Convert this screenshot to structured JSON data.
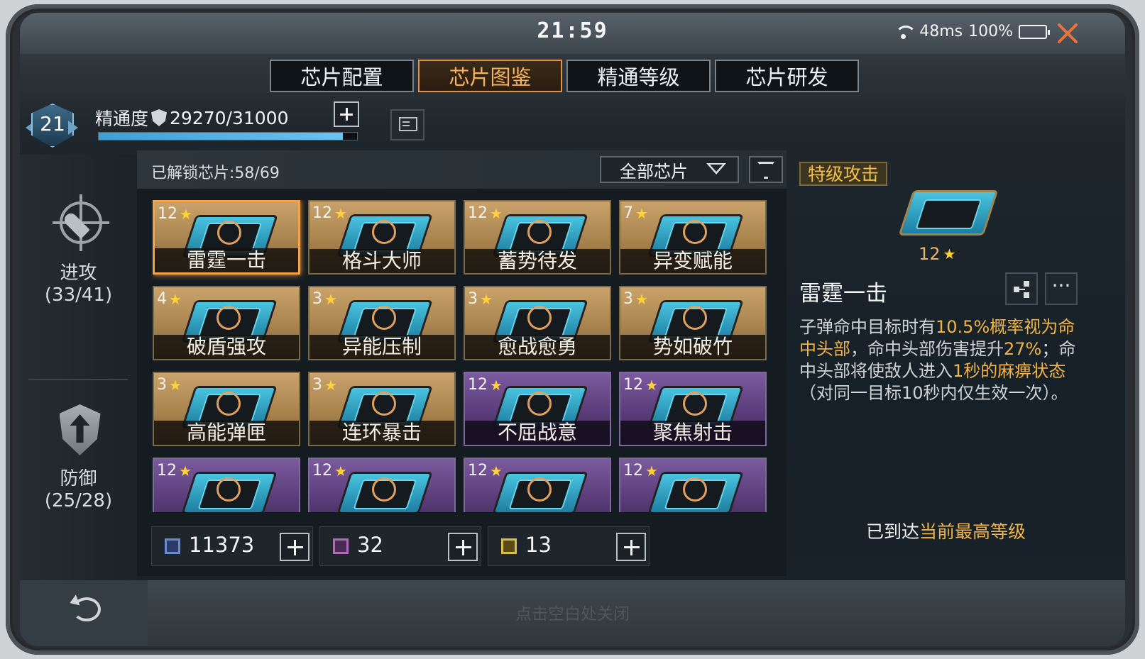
{
  "status_bar": {
    "time": "21:59",
    "ping": "48ms",
    "battery": "100%"
  },
  "tabs": [
    {
      "label": "芯片配置",
      "active": false
    },
    {
      "label": "芯片图鉴",
      "active": true
    },
    {
      "label": "精通等级",
      "active": false
    },
    {
      "label": "芯片研发",
      "active": false
    }
  ],
  "mastery": {
    "level": "21",
    "label": "精通度",
    "value": "29270/31000",
    "progress": 0.944
  },
  "categories": {
    "attack": {
      "name": "进攻",
      "count": "(33/41)"
    },
    "defense": {
      "name": "防御",
      "count": "(25/28)"
    }
  },
  "grid": {
    "unlocked": "已解锁芯片:58/69",
    "filter": "全部芯片",
    "chips": [
      {
        "level": "12",
        "name": "雷霆一击",
        "rarity": "gold",
        "selected": true
      },
      {
        "level": "12",
        "name": "格斗大师",
        "rarity": "gold"
      },
      {
        "level": "12",
        "name": "蓄势待发",
        "rarity": "gold"
      },
      {
        "level": "7",
        "name": "异变赋能",
        "rarity": "gold"
      },
      {
        "level": "4",
        "name": "破盾强攻",
        "rarity": "gold"
      },
      {
        "level": "3",
        "name": "异能压制",
        "rarity": "gold"
      },
      {
        "level": "3",
        "name": "愈战愈勇",
        "rarity": "gold"
      },
      {
        "level": "3",
        "name": "势如破竹",
        "rarity": "gold"
      },
      {
        "level": "3",
        "name": "高能弹匣",
        "rarity": "gold"
      },
      {
        "level": "3",
        "name": "连环暴击",
        "rarity": "gold"
      },
      {
        "level": "12",
        "name": "不屈战意",
        "rarity": "purple"
      },
      {
        "level": "12",
        "name": "聚焦射击",
        "rarity": "purple"
      },
      {
        "level": "12",
        "name": "",
        "rarity": "purple"
      },
      {
        "level": "12",
        "name": "",
        "rarity": "purple"
      },
      {
        "level": "12",
        "name": "",
        "rarity": "purple"
      },
      {
        "level": "12",
        "name": "",
        "rarity": "purple"
      }
    ]
  },
  "currencies": [
    {
      "value": "11373",
      "color": "blue"
    },
    {
      "value": "32",
      "color": "purple"
    },
    {
      "value": "13",
      "color": "gold"
    }
  ],
  "detail": {
    "tag": "特级攻击",
    "level": "12",
    "name": "雷霆一击",
    "more_label": "···",
    "desc_1": "子弹命中目标时有",
    "desc_hl_1": "10.5%概率视为命中头部",
    "desc_2": "，命中头部伤害提升",
    "desc_hl_2": "27%",
    "desc_3": "；命中头部将使敌人进入",
    "desc_hl_3": "1秒的麻痹状态",
    "desc_4": "（对同一目标10秒内仅生效一次）。",
    "max_prefix": "已到达",
    "max_hl": "当前最高等级"
  },
  "bottom": {
    "close_hint": "点击空白处关闭"
  },
  "colors": {
    "accent": "#e49145",
    "highlight": "#f2b448",
    "close": "#e8743a"
  }
}
